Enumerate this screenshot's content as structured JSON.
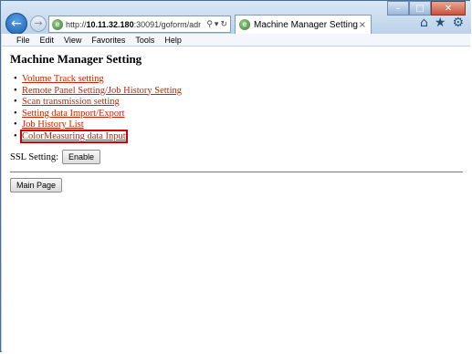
{
  "browser": {
    "address_prefix": "http://",
    "address_host": "10.11.32.180",
    "address_rest": ":30091/goform/admin_en...",
    "address_search_icon": "⚲",
    "address_dropdown_icon": "▾",
    "address_refresh_icon": "↻",
    "tab_title": "Machine Manager Setting",
    "tab_close": "×"
  },
  "window_controls": {
    "minimize": "–",
    "maximize": "□",
    "close": "✕"
  },
  "menu": {
    "file": "File",
    "edit": "Edit",
    "view": "View",
    "favorites": "Favorites",
    "tools": "Tools",
    "help": "Help"
  },
  "page": {
    "title": "Machine Manager Setting",
    "links": [
      "Volume Track setting",
      "Remote Panel Setting/Job History Setting",
      "Scan transmission setting",
      "Setting data Import/Export",
      "Job History List",
      "ColorMeasuring data Input"
    ],
    "ssl_label": "SSL Setting:",
    "enable_button": "Enable",
    "main_page_button": "Main Page"
  },
  "colors": {
    "link": "#cc2200",
    "highlight_box": "#d40000"
  }
}
